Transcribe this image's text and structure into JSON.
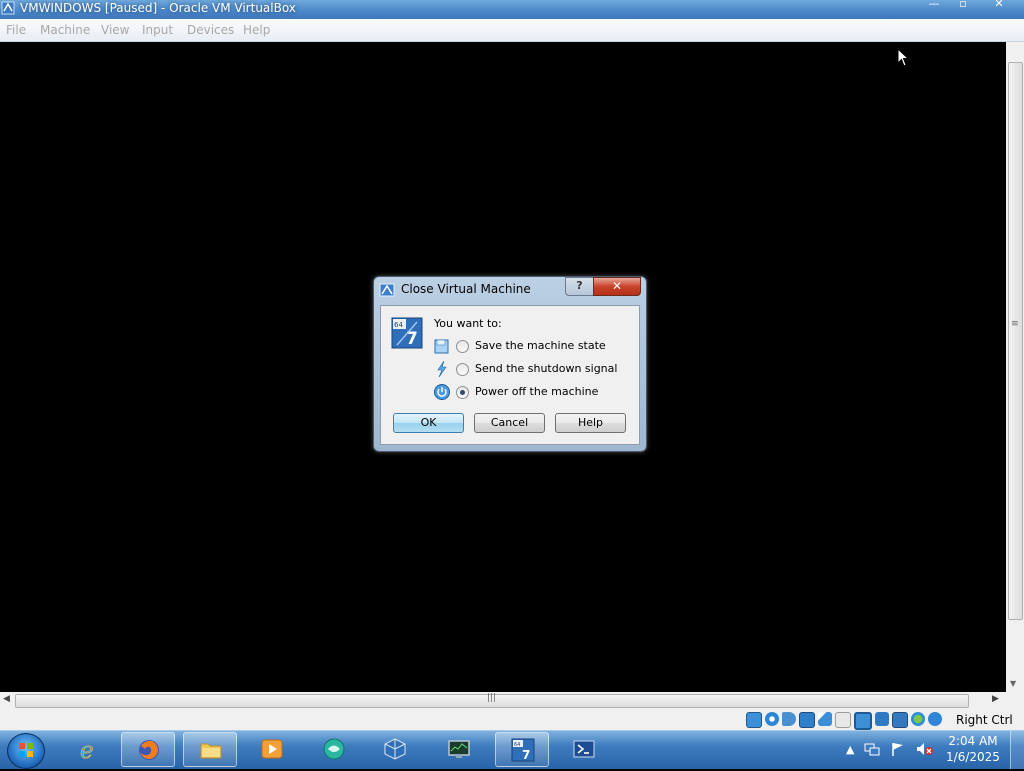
{
  "window": {
    "title": "VMWINDOWS [Paused] - Oracle VM VirtualBox",
    "minimize_label": "—",
    "maximize_label": "▫",
    "close_label": "✕"
  },
  "menu": {
    "items": [
      "File",
      "Machine",
      "View",
      "Input",
      "Devices",
      "Help"
    ]
  },
  "dialog": {
    "title": "Close Virtual Machine",
    "help_glyph": "?",
    "close_glyph": "✕",
    "prompt": "You want to:",
    "options": [
      {
        "label": "Save the machine state",
        "icon": "save-state-icon",
        "selected": false
      },
      {
        "label": "Send the shutdown signal",
        "icon": "shutdown-signal-icon",
        "selected": false
      },
      {
        "label": "Power off the machine",
        "icon": "power-off-icon",
        "selected": true
      }
    ],
    "buttons": {
      "ok": "OK",
      "cancel": "Cancel",
      "help": "Help"
    }
  },
  "statusbar": {
    "host_key": "Right Ctrl",
    "icons": [
      "hard-disk-icon",
      "optical-drive-icon",
      "audio-icon",
      "network-icon",
      "usb-icon",
      "shared-folders-icon",
      "display-icon",
      "video-capture-icon",
      "guest-additions-icon",
      "cpu-icon",
      "mouse-integration-icon"
    ]
  },
  "taskbar": {
    "apps": [
      {
        "name": "internet-explorer",
        "open": false
      },
      {
        "name": "firefox",
        "open": true
      },
      {
        "name": "file-explorer",
        "open": true
      },
      {
        "name": "media-player",
        "open": false
      },
      {
        "name": "app-bubble",
        "open": false
      },
      {
        "name": "virtualbox",
        "open": false
      },
      {
        "name": "system-monitor",
        "open": false
      },
      {
        "name": "vm-windows7",
        "open": true
      },
      {
        "name": "powershell",
        "open": false
      }
    ],
    "time": "2:04 AM",
    "date": "1/6/2025"
  },
  "colors": {
    "title_bar": "#4a86c8",
    "taskbar": "#3d7bbf",
    "dialog_frame": "#bcd0e4",
    "default_button": "#98d1ef"
  }
}
